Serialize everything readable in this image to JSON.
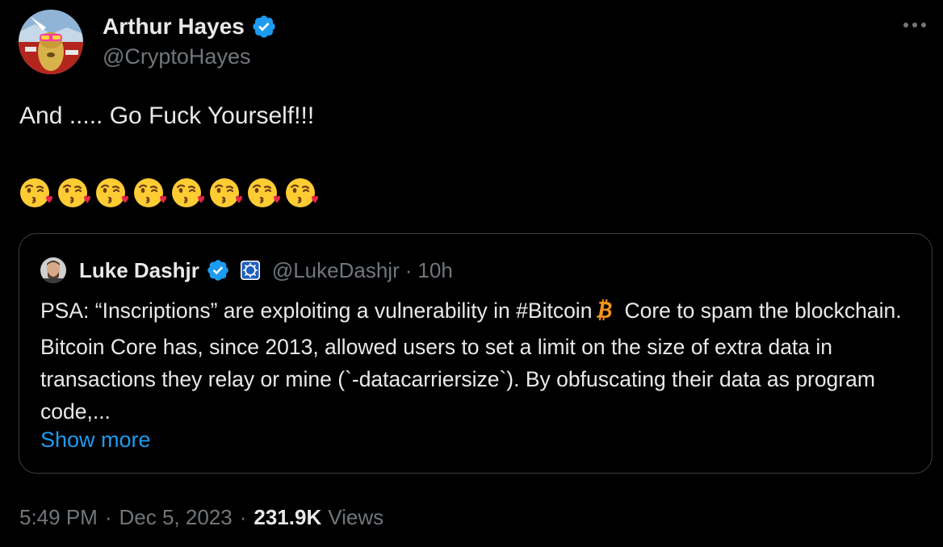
{
  "author": {
    "display_name": "Arthur Hayes",
    "handle": "@CryptoHayes",
    "verified": true,
    "verified_icon": "verified-badge-icon",
    "avatar_icon": "avatar-illustration"
  },
  "tweet": {
    "text": "And ..... Go Fuck Yourself!!!",
    "emoji": [
      "😘",
      "😘",
      "😘",
      "😘",
      "😘",
      "😘",
      "😘",
      "😘"
    ]
  },
  "quote": {
    "display_name": "Luke Dashjr",
    "handle": "@LukeDashjr",
    "separator": "·",
    "time": "10h",
    "verified": true,
    "affiliate_icon": "affiliate-badge-icon",
    "text_before_icon": "PSA: “Inscriptions” are exploiting a vulnerability in #Bitcoin",
    "inline_icon": "bitcoin-icon",
    "text_after_icon": "Core to spam the blockchain. Bitcoin Core has, since 2013, allowed users to set a limit on the size of extra data in transactions they relay or mine (`-datacarriersize`). By obfuscating their data as program code,...",
    "show_more_label": "Show more"
  },
  "meta": {
    "time": "5:49 PM",
    "separator": "·",
    "date": "Dec 5, 2023",
    "views_count": "231.9K",
    "views_label": "Views"
  },
  "colors": {
    "background": "#000000",
    "text_primary": "#e7e9ea",
    "text_secondary": "#71767b",
    "accent": "#1d9bf0",
    "border": "#3a3f44",
    "bitcoin": "#f7931a"
  }
}
